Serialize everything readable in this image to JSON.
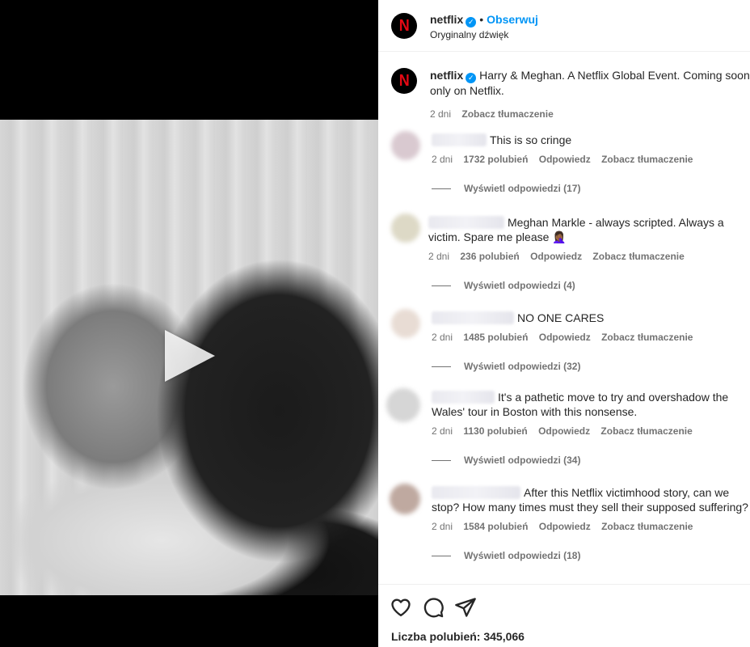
{
  "header": {
    "username": "netflix",
    "follow_label": "Obserwuj",
    "audio_label": "Oryginalny dźwięk",
    "logo_letter": "N"
  },
  "caption": {
    "username": "netflix",
    "text": "Harry & Meghan. A Netflix Global Event. Coming soon only on Netflix.",
    "time": "2 dni",
    "translate": "Zobacz tłumaczenie"
  },
  "comments": [
    {
      "text": "This is so cringe",
      "time": "2 dni",
      "likes": "1732 polubień",
      "reply": "Odpowiedz",
      "translate": "Zobacz tłumaczenie",
      "view_replies": "Wyświetl odpowiedzi (17)",
      "avatar_color": "#d9c9d0"
    },
    {
      "text": "Meghan Markle - always scripted. Always a victim. Spare me please 🤦🏾‍♀️",
      "time": "2 dni",
      "likes": "236 polubień",
      "reply": "Odpowiedz",
      "translate": "Zobacz tłumaczenie",
      "view_replies": "Wyświetl odpowiedzi (4)",
      "avatar_color": "#ddd9c6"
    },
    {
      "text": "NO ONE CARES",
      "time": "2 dni",
      "likes": "1485 polubień",
      "reply": "Odpowiedz",
      "translate": "Zobacz tłumaczenie",
      "view_replies": "Wyświetl odpowiedzi (32)",
      "avatar_color": "#e8dcd4"
    },
    {
      "text": "It's a pathetic move to try and overshadow the Wales' tour in Boston with this nonsense.",
      "time": "2 dni",
      "likes": "1130 polubień",
      "reply": "Odpowiedz",
      "translate": "Zobacz tłumaczenie",
      "view_replies": "Wyświetl odpowiedzi (34)",
      "avatar_color": "#d6d6d6"
    },
    {
      "text": "After this Netflix victimhood story, can we stop? How many times must they sell their supposed suffering?",
      "time": "2 dni",
      "likes": "1584 polubień",
      "reply": "Odpowiedz",
      "translate": "Zobacz tłumaczenie",
      "view_replies": "Wyświetl odpowiedzi (18)",
      "avatar_color": "#bfa9a0"
    }
  ],
  "actions": {
    "like_icon": "heart-icon",
    "comment_icon": "comment-icon",
    "share_icon": "share-icon"
  },
  "likes_label": "Liczba polubień: 345,066",
  "colors": {
    "accent": "#0095f6",
    "netflix_red": "#e50914",
    "secondary_text": "#737373"
  }
}
